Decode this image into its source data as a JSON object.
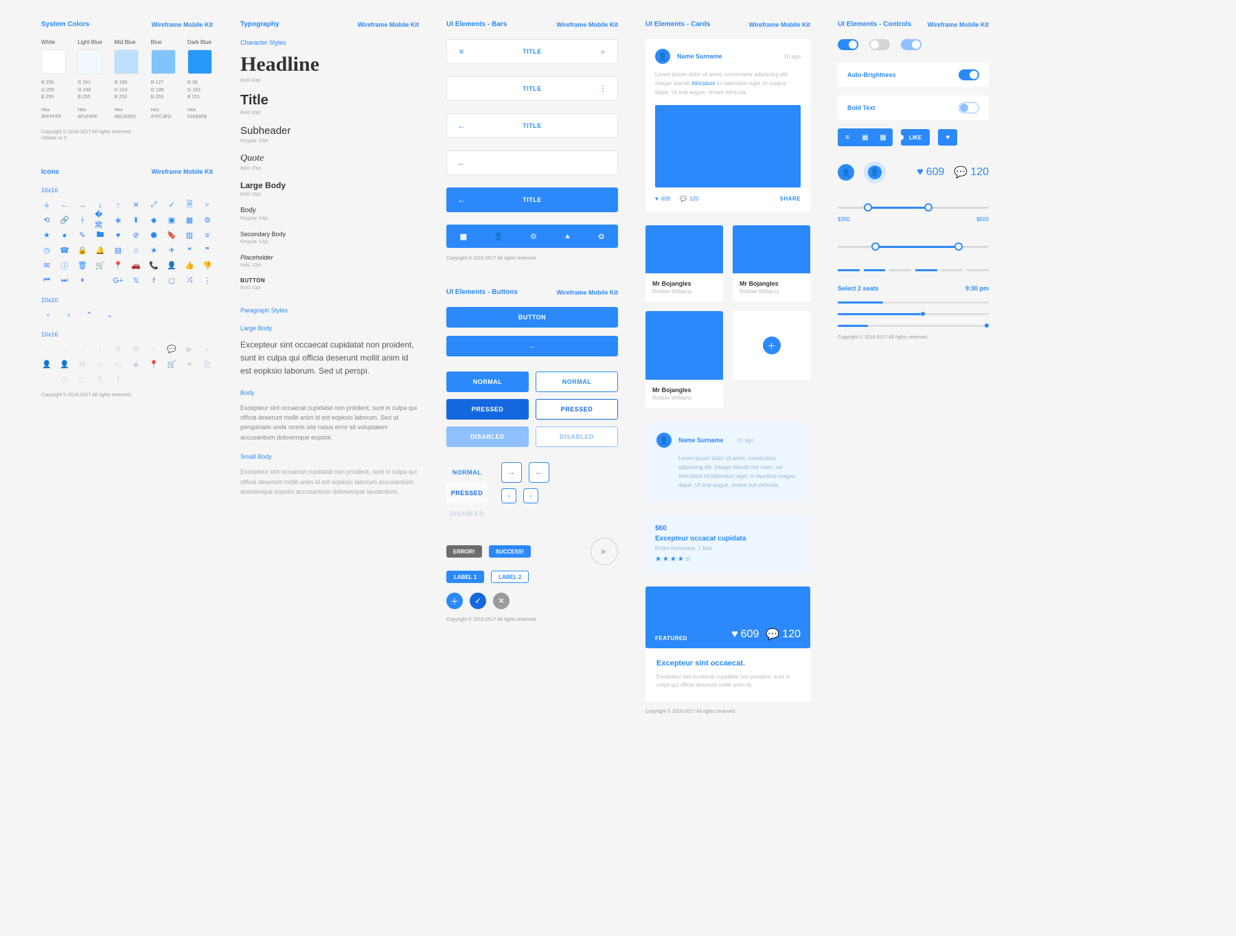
{
  "brand": "Wireframe Mobile Kit",
  "copyright": "Copyright © 2016-2017 All rights reserved.",
  "version": "UIbase v1.0",
  "colors": {
    "title": "System Colors",
    "swatches": [
      {
        "name": "White",
        "hex": "#FFFFFF",
        "r": "R 255",
        "g": "G 255",
        "b": "B 255",
        "hexLabel": "Hex",
        "hexValue": "#FFFFFF"
      },
      {
        "name": "Light Blue",
        "hex": "#F1F9FF",
        "r": "R 241",
        "g": "G 249",
        "b": "B 255",
        "hexLabel": "Hex",
        "hexValue": "#F1F9FF"
      },
      {
        "name": "Mid Blue",
        "hex": "#BCE0FD",
        "r": "R 188",
        "g": "G 224",
        "b": "B 253",
        "hexLabel": "Hex",
        "hexValue": "#BCE0FD"
      },
      {
        "name": "Blue",
        "hex": "#7FC4FD",
        "r": "R 127",
        "g": "G 196",
        "b": "B 253",
        "hexLabel": "Hex",
        "hexValue": "#7FC4FD"
      },
      {
        "name": "Dark Blue",
        "hex": "#2699FB",
        "r": "R 38",
        "g": "G 153",
        "b": "B 251",
        "hexLabel": "Hex",
        "hexValue": "#2699FB"
      }
    ]
  },
  "icons": {
    "title": "Icons",
    "size1": "16x16",
    "size2": "10x10",
    "size3": "16x16"
  },
  "typo": {
    "title": "Typography",
    "charHeader": "Character Styles",
    "styles": {
      "headline": {
        "label": "Headline",
        "meta": "Bold 40pt"
      },
      "title": {
        "label": "Title",
        "meta": "Bold 30pt"
      },
      "sub": {
        "label": "Subheader",
        "meta": "Regular 20pt"
      },
      "quote": {
        "label": "Quote",
        "meta": "Italic 20pt"
      },
      "lbody": {
        "label": "Large Body",
        "meta": "Bold 16pt"
      },
      "body": {
        "label": "Body",
        "meta": "Regular 14pt"
      },
      "sbody": {
        "label": "Secondary Body",
        "meta": "Regular 12pt"
      },
      "ph": {
        "label": "Placeholder",
        "meta": "Italic 12pt"
      },
      "btn": {
        "label": "BUTTON",
        "meta": "Bold 10pt"
      }
    },
    "paraHeader": "Paragraph Styles",
    "lb": {
      "title": "Large Body",
      "text": "Excepteur sint occaecat cupidatat non proident, sunt in culpa qui officia deserunt mollit anim id est eopksio laborum. Sed ut perspi."
    },
    "b": {
      "title": "Body",
      "text": "Excepteur sint occaecat cupidatat non proident, sunt in culpa qui officia deserunt mollit anim id est eopksio laborum. Sed ut perspiciatis unde omnis iste natus error sit voluptatem accusantium doloremque eopsloi."
    },
    "sb": {
      "title": "Small Body",
      "text": "Excepteur sint occaecat cupidatat non proident, sunt in culpa qui officia deserunt mollit anim id est eopksio laborum accusantium doloremque eopsloi accusantium doloremque laudantium."
    }
  },
  "bars": {
    "title": "UI Elements - Bars",
    "label": "TITLE"
  },
  "buttons": {
    "title": "UI Elements - Buttons",
    "primary": "BUTTON",
    "normal": "NORMAL",
    "pressed": "PRESSED",
    "disabled": "DISABLED",
    "error": "ERROR!",
    "success": "SUCCESS!",
    "label1": "LABEL 1",
    "label2": "LABEL 2"
  },
  "cards": {
    "title": "UI Elements - Cards",
    "user": "Name Surname",
    "ago": "1h ago",
    "lorem": "Lorem ipsum dolor sit amet, consectetur adipiscing elit. Integer blandit nisi nunc, vel #tincidunt mi bibendum eget. In faucibus magna dapie. Ut erat augue, ornare eut vehicula.",
    "likes": "609",
    "comments": "120",
    "share": "SHARE",
    "mini": {
      "name": "Mr Bojangles",
      "sub": "Robbie Williams"
    },
    "price": {
      "amount": "$60",
      "title": "Excepteur occacat cupidata",
      "sub": "Entire homecept, 1 bed"
    },
    "featured": "FEATURED",
    "article": {
      "title": "Excepteur sint occaecat.",
      "text": "Excepteur sint occaecat cupidatat non proident, sunt in culpa qui officia deserunt mollit anim id."
    }
  },
  "controls": {
    "title": "UI Elements - Controls",
    "autoBrightness": "Auto-Brightness",
    "boldText": "Bold Text",
    "like": "LIKE",
    "stat1": "609",
    "stat2": "120",
    "priceLow": "$300",
    "priceHigh": "$500",
    "seats": "Select 2 seats",
    "time": "9:30 pm"
  }
}
